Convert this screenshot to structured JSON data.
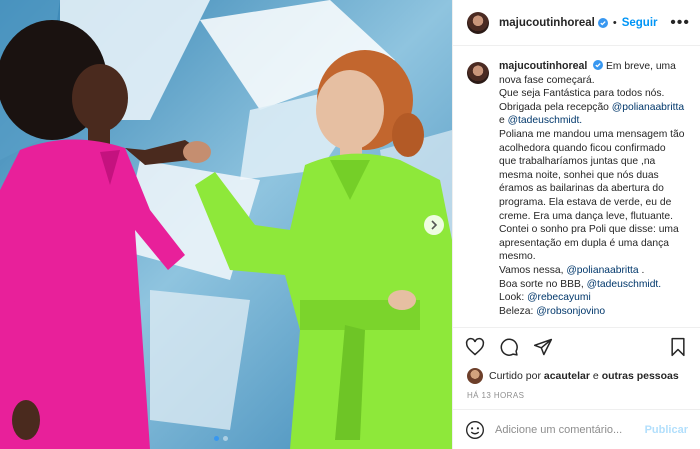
{
  "post": {
    "username": "majucoutinhoreal",
    "follow_label": "Seguir",
    "more_label": "•••",
    "caption_lines": [
      "Em breve, uma",
      "nova fase começará.",
      "Que seja Fantástica para todos nós.",
      "Obrigada pela recepção",
      "e",
      "Poliana me mandou uma mensagem tão",
      "acolhedora quando ficou confirmado",
      "que trabalharíamos juntas que ,na",
      "mesma noite, sonhei que nós duas",
      "éramos as bailarinas da abertura do",
      "programa. Ela estava de verde, eu de",
      "creme. Era uma dança leve, flutuante.",
      "Contei o sonho pra Poli que disse: uma",
      "apresentação em dupla é uma dança",
      "mesmo.",
      "Vamos nessa,",
      "Boa sorte no BBB,",
      "Look:",
      "Beleza:"
    ],
    "mentions": {
      "poliana": "@polianaabritta",
      "tadeu": "@tadeuschmidt.",
      "poliana2": "@polianaabritta",
      "tadeu2": "@tadeuschmidt.",
      "rebeca": "@rebecayumi",
      "robson": "@robsonjovino"
    },
    "period": " ."
  },
  "likes": {
    "prefix": "Curtido por",
    "user": "acautelar",
    "mid": "e",
    "others": "outras pessoas"
  },
  "time_label": "HÁ 13 HORAS",
  "comment": {
    "placeholder": "Adicione um comentário...",
    "publish_label": "Publicar"
  },
  "colors": {
    "accent": "#0095f6",
    "publish_disabled": "#b2dffc",
    "mention": "#00376b",
    "pink_dress": "#e8209a",
    "green_dress": "#8ee83a"
  },
  "carousel": {
    "slides": 2,
    "active": 0
  }
}
